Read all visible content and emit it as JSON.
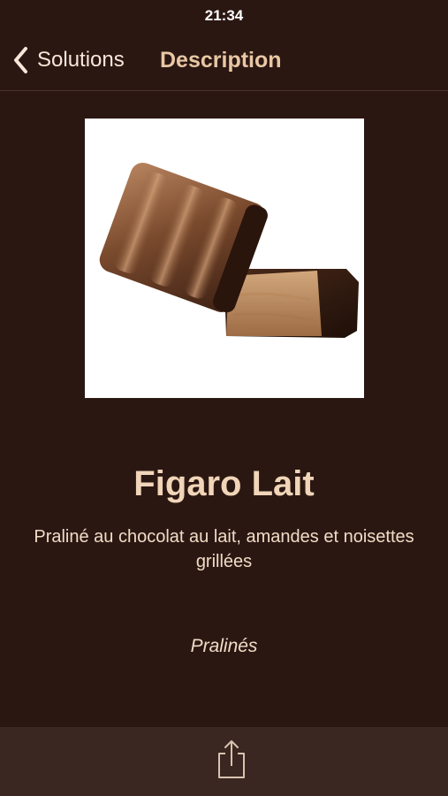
{
  "status_bar": {
    "time": "21:34"
  },
  "nav": {
    "back_label": "Solutions",
    "title": "Description"
  },
  "product": {
    "name": "Figaro Lait",
    "description": "Praliné au chocolat au lait, amandes et noisettes grillées",
    "category": "Pralinés"
  },
  "toolbar": {
    "share_icon": "share-icon"
  },
  "colors": {
    "background": "#2b1712",
    "toolbar_background": "#3a2721",
    "title_accent": "#e8c7a4",
    "text": "#f1dcc6"
  }
}
